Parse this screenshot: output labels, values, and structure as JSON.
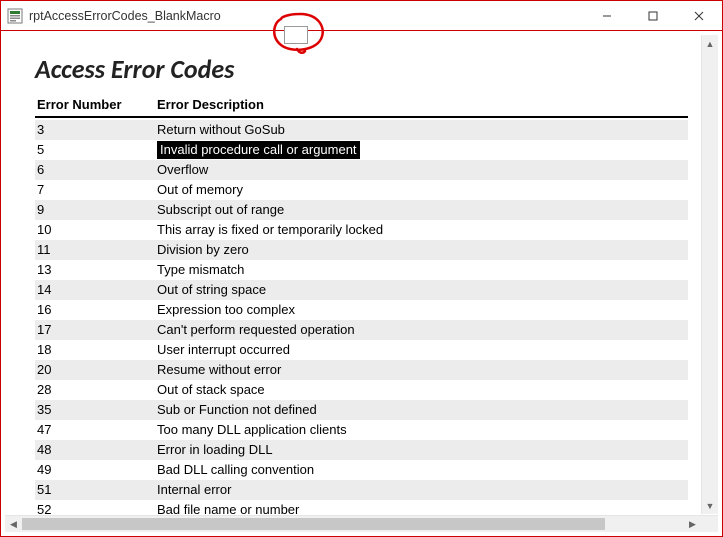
{
  "window": {
    "title": "rptAccessErrorCodes_BlankMacro"
  },
  "report": {
    "title": "Access Error Codes",
    "columns": {
      "number": "Error Number",
      "description": "Error Description"
    },
    "highlighted_row_index": 1,
    "rows": [
      {
        "num": "3",
        "desc": "Return without GoSub"
      },
      {
        "num": "5",
        "desc": "Invalid procedure call or argument"
      },
      {
        "num": "6",
        "desc": "Overflow"
      },
      {
        "num": "7",
        "desc": "Out of memory"
      },
      {
        "num": "9",
        "desc": "Subscript out of range"
      },
      {
        "num": "10",
        "desc": "This array is fixed or temporarily locked"
      },
      {
        "num": "11",
        "desc": "Division by zero"
      },
      {
        "num": "13",
        "desc": "Type mismatch"
      },
      {
        "num": "14",
        "desc": "Out of string space"
      },
      {
        "num": "16",
        "desc": "Expression too complex"
      },
      {
        "num": "17",
        "desc": "Can't perform requested operation"
      },
      {
        "num": "18",
        "desc": "User interrupt occurred"
      },
      {
        "num": "20",
        "desc": "Resume without error"
      },
      {
        "num": "28",
        "desc": "Out of stack space"
      },
      {
        "num": "35",
        "desc": "Sub or Function not defined"
      },
      {
        "num": "47",
        "desc": "Too many DLL application clients"
      },
      {
        "num": "48",
        "desc": "Error in loading DLL"
      },
      {
        "num": "49",
        "desc": "Bad DLL calling convention"
      },
      {
        "num": "51",
        "desc": "Internal error"
      },
      {
        "num": "52",
        "desc": "Bad file name or number"
      }
    ]
  }
}
